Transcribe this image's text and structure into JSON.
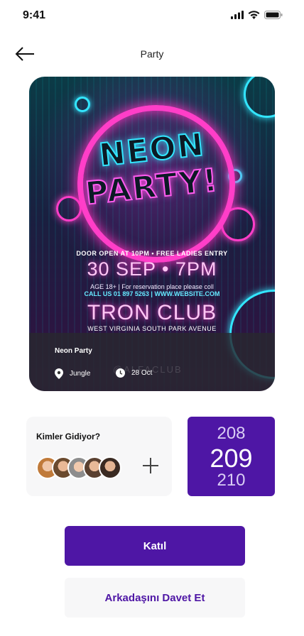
{
  "status_bar": {
    "time": "9:41",
    "icons": [
      "cellular-signal-icon",
      "wifi-icon",
      "battery-icon"
    ]
  },
  "header": {
    "title": "Party",
    "back_icon": "arrow-left-icon"
  },
  "event": {
    "poster": {
      "headline_line1": "NEON",
      "headline_line2": "PARTY!",
      "door_info": "DOOR OPEN AT 10PM • FREE LADIES ENTRY",
      "date_time": "30 SEP • 7PM",
      "age_info": "AGE 18+ | For reservation place please coll",
      "contact": "CALL US 01 897 5263 | WWW.WEBSITE.COM",
      "venue": "TRON CLUB",
      "address": "WEST VIRGINIA SOUTH PARK AVENUE",
      "watermark": "@ALFACLUB"
    },
    "name": "Neon Party",
    "location": "Jungle",
    "date": "28 Oct",
    "location_icon": "location-pin-icon",
    "clock_icon": "clock-icon"
  },
  "attendees": {
    "label": "Kimler Gidiyor?",
    "count_avatars": 5,
    "add_icon": "plus-icon"
  },
  "counter": {
    "previous": "208",
    "current": "209",
    "next": "210"
  },
  "actions": {
    "join_label": "Katıl",
    "invite_label": "Arkadaşını Davet Et"
  },
  "colors": {
    "accent": "#4e16a5",
    "card_bg": "#f7f7f8",
    "neon_pink": "#ff3ec8",
    "neon_cyan": "#33e6ff"
  }
}
